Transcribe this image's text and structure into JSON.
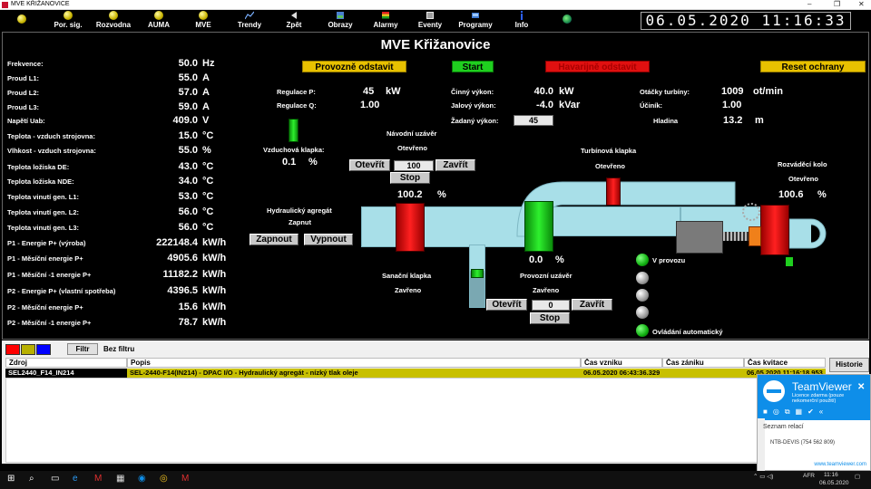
{
  "window": {
    "title": "MVE KŘIŽANOVICE",
    "minimize": "–",
    "maximize": "❐",
    "close": "✕"
  },
  "toolbar": {
    "items": [
      {
        "label": "Por. sig."
      },
      {
        "label": "Rozvodna"
      },
      {
        "label": "AUMA"
      },
      {
        "label": "MVE"
      },
      {
        "label": "Trendy"
      },
      {
        "label": "Zpět"
      },
      {
        "label": "Obrazy"
      },
      {
        "label": "Alarmy"
      },
      {
        "label": "Eventy"
      },
      {
        "label": "Programy"
      },
      {
        "label": "Info"
      }
    ],
    "clock": "06.05.2020  11:16:33"
  },
  "page": {
    "title": "MVE Křižanovice"
  },
  "controls": {
    "provozne_odstavit": "Provozně odstavit",
    "start": "Start",
    "havarijne_odstavit": "Havarijně odstavit",
    "reset_ochrany": "Reset ochrany"
  },
  "measurements": [
    {
      "label": "Frekvence:",
      "value": "50.0",
      "unit": "Hz"
    },
    {
      "label": "Proud L1:",
      "value": "55.0",
      "unit": "A"
    },
    {
      "label": "Proud L2:",
      "value": "57.0",
      "unit": "A"
    },
    {
      "label": "Proud L3:",
      "value": "59.0",
      "unit": "A"
    },
    {
      "label": "Napětí Uab:",
      "value": "409.0",
      "unit": "V"
    },
    {
      "label": "Teplota - vzduch strojovna:",
      "value": "15.0",
      "unit": "°C"
    },
    {
      "label": "Vlhkost - vzduch strojovna:",
      "value": "55.0",
      "unit": "%"
    },
    {
      "label": "Teplota ložiska DE:",
      "value": "43.0",
      "unit": "°C"
    },
    {
      "label": "Teplota ložiska NDE:",
      "value": "34.0",
      "unit": "°C"
    },
    {
      "label": "Teplota vinutí gen. L1:",
      "value": "53.0",
      "unit": "°C"
    },
    {
      "label": "Teplota vinutí gen. L2:",
      "value": "56.0",
      "unit": "°C"
    },
    {
      "label": "Teplota vinutí gen. L3:",
      "value": "56.0",
      "unit": "°C"
    },
    {
      "label": "P1 - Energie P+ (výroba)",
      "value": "222148.4",
      "unit": "kW/h"
    },
    {
      "label": "P1 - Měsíční energie P+",
      "value": "4905.6",
      "unit": "kW/h"
    },
    {
      "label": "P1 - Měsíční -1 energie P+",
      "value": "11182.2",
      "unit": "kW/h"
    },
    {
      "label": "P2 - Energie P+ (vlastní spotřeba)",
      "value": "4396.5",
      "unit": "kW/h"
    },
    {
      "label": "P2 - Měsíční energie P+",
      "value": "15.6",
      "unit": "kW/h"
    },
    {
      "label": "P2 - Měsíční -1 energie P+",
      "value": "78.7",
      "unit": "kW/h"
    }
  ],
  "regulation": {
    "p_label": "Regulace P:",
    "p_value": "45",
    "p_unit": "kW",
    "q_label": "Regulace Q:",
    "q_value": "1.00"
  },
  "power": {
    "cinny_label": "Činný výkon:",
    "cinny_value": "40.0",
    "cinny_unit": "kW",
    "jalovy_label": "Jalový výkon:",
    "jalovy_value": "-4.0",
    "jalovy_unit": "kVar",
    "zadany_label": "Žadaný výkon:",
    "zadany_value": "45"
  },
  "turbine": {
    "otacky_label": "Otáčky turbíny:",
    "otacky_value": "1009",
    "otacky_unit": "ot/min",
    "ucinik_label": "Účiník:",
    "ucinik_value": "1.00",
    "hladina_label": "Hladina",
    "hladina_value": "13.2",
    "hladina_unit": "m"
  },
  "scheme": {
    "vzduchova_klapka_label": "Vzduchová klapka:",
    "vzduchova_klapka_value": "0.1",
    "vzduchova_klapka_unit": "%",
    "navodni_uzaver_label": "Návodní uzávěr",
    "navodni_uzaver_state": "Otevřeno",
    "navodni_otevrit": "Otevřít",
    "navodni_field": "100",
    "navodni_zavrit": "Zavřít",
    "navodni_stop": "Stop",
    "navodni_percent": "100.2",
    "navodni_unit": "%",
    "hydraulicky_agregat_label": "Hydraulický agregát",
    "hydraulicky_agregat_state": "Zapnut",
    "zapnout": "Zapnout",
    "vypnout": "Vypnout",
    "turbinova_klapka_label": "Turbínová klapka",
    "turbinova_klapka_state": "Otevřeno",
    "rozvadeci_kolo_label": "Rozváděcí kolo",
    "rozvadeci_kolo_state": "Otevřeno",
    "rozvadeci_percent": "100.6",
    "rozvadeci_unit": "%",
    "provozni_percent": "0.0",
    "provozni_unit": "%",
    "provozni_uzaver_label": "Provozní uzávěr",
    "provozni_uzaver_state": "Zavřeno",
    "provozni_otevrit": "Otevřít",
    "provozni_field": "0",
    "provozni_zavrit": "Zavřít",
    "provozni_stop": "Stop",
    "sanacni_klapka_label": "Sanační klapka",
    "sanacni_klapka_state": "Zavřeno",
    "v_provozu": "V provozu",
    "ovladani_automaticky": "Ovládání automatický"
  },
  "alarm": {
    "filter_btn": "Filtr",
    "no_filter": "Bez filtru",
    "columns": {
      "zdroj": "Zdroj",
      "popis": "Popis",
      "cas_vzniku": "Čas vzniku",
      "cas_zaniku": "Čas zániku",
      "cas_kvitace": "Čas kvitace"
    },
    "historie": "Historie",
    "row": {
      "zdroj": "SEL2440_F14_IN214",
      "popis": "SEL-2440-F14(IN214) - DPAC I/O - Hydraulický agregát - nízký tlak oleje",
      "cas_vzniku": "06.05.2020 06:43:36.329",
      "cas_zaniku": "",
      "cas_kvitace": "06.05.2020 11:16:18.953"
    },
    "colors": {
      "red": "#ff0000",
      "olive": "#b8b000",
      "blue": "#0000ff",
      "row_bg": "#c8c000"
    }
  },
  "teamviewer": {
    "title": "TeamViewer",
    "subtitle": "Licence zdarma (pouze nekomerční použití)",
    "sessions": "Seznam relací",
    "item": "NTB-DEVIS (754 562 809)",
    "link": "www.teamviewer.com"
  },
  "taskbar": {
    "lang": "AFR",
    "time": "11:16",
    "date": "06.05.2020"
  }
}
